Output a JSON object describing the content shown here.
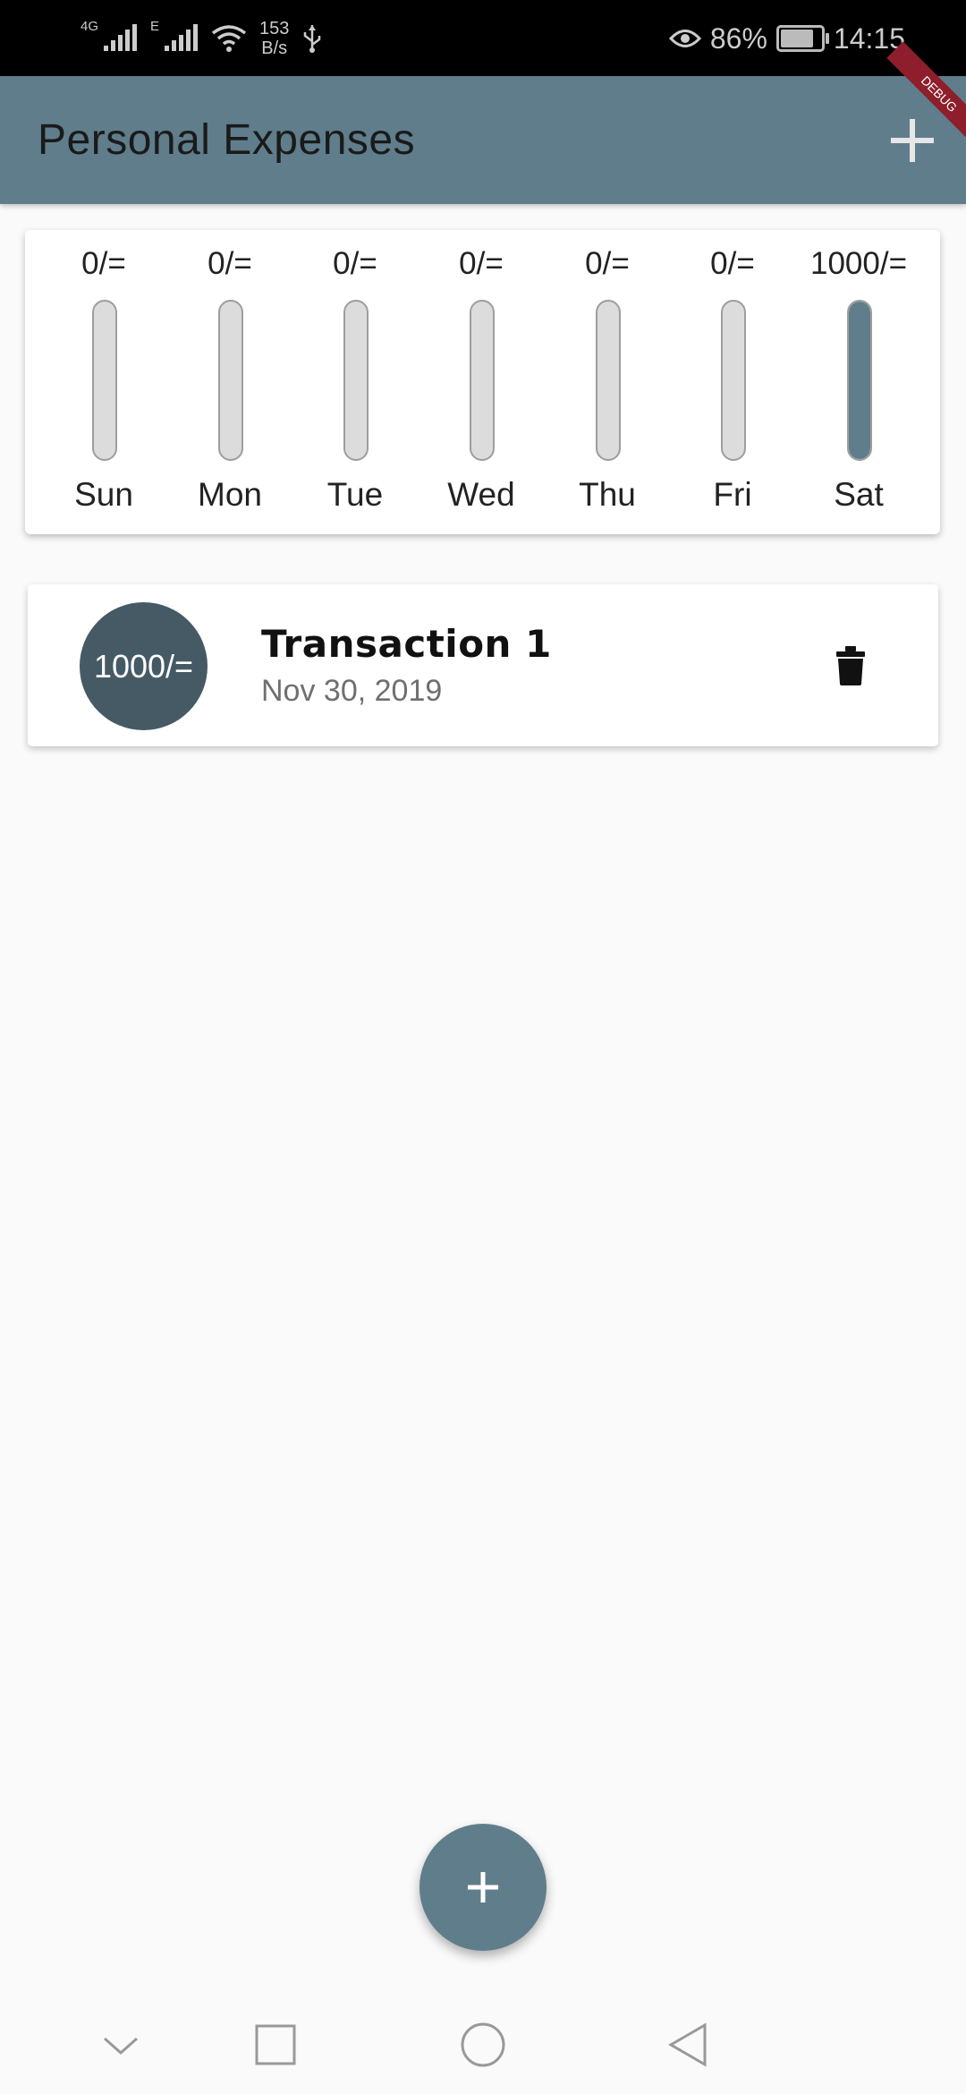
{
  "status_bar": {
    "network1": "4G",
    "network2": "E",
    "speed_value": "153",
    "speed_unit": "B/s",
    "battery_percent": "86%",
    "battery_level": 0.86,
    "time": "14:15"
  },
  "app_bar": {
    "title": "Personal Expenses",
    "add_icon": "plus-icon"
  },
  "debug_banner": {
    "label": "DEBUG",
    "color": "#8e1e2b"
  },
  "chart_data": {
    "type": "bar",
    "categories": [
      "Sun",
      "Mon",
      "Tue",
      "Wed",
      "Thu",
      "Fri",
      "Sat"
    ],
    "value_labels": [
      "0/=",
      "0/=",
      "0/=",
      "0/=",
      "0/=",
      "0/=",
      "1000/="
    ],
    "values": [
      0,
      0,
      0,
      0,
      0,
      0,
      1000
    ],
    "fill_fractions": [
      0,
      0,
      0,
      0,
      0,
      0,
      1
    ],
    "colors": {
      "fill": "#607d8b",
      "track": "#dcdcdc",
      "track_border": "#9e9e9e"
    }
  },
  "transactions": [
    {
      "amount": "1000/=",
      "title": "Transaction 1",
      "date": "Nov 30, 2019",
      "delete_icon": "trash-icon"
    }
  ],
  "fab": {
    "icon": "plus-icon"
  },
  "nav_bar": {
    "icons": [
      "chevron-down-icon",
      "square-icon",
      "circle-icon",
      "back-triangle-icon"
    ]
  },
  "colors": {
    "primary": "#607d8b",
    "avatar": "#455a64",
    "background": "#fafafa"
  }
}
